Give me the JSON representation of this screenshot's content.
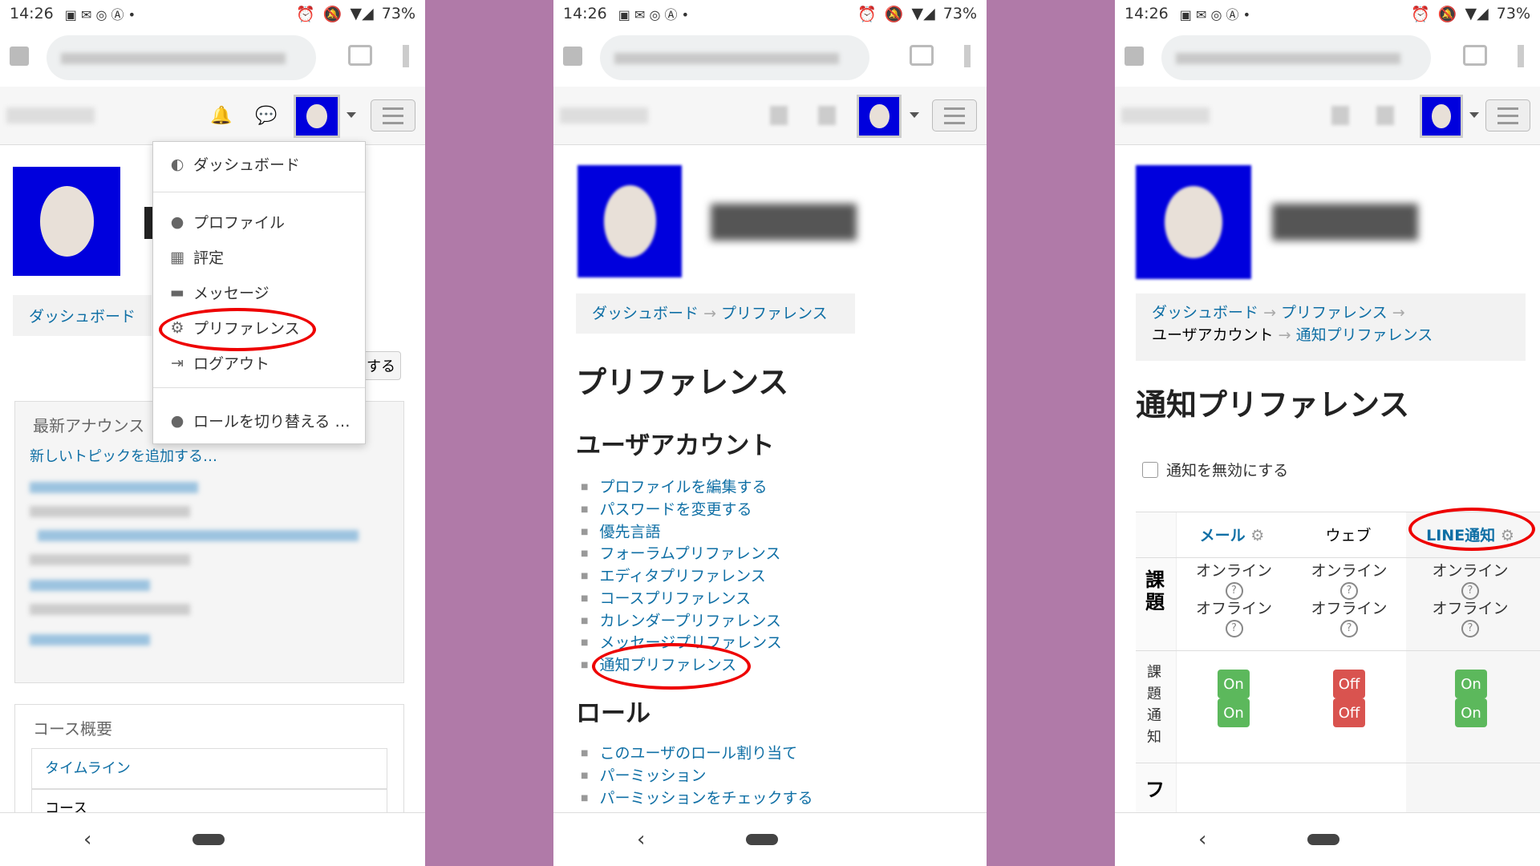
{
  "status": {
    "time": "14:26",
    "battery": "73%"
  },
  "panel1": {
    "menu": [
      {
        "icon": "dashboard-icon",
        "label": "ダッシュボード"
      },
      {
        "icon": "user-icon",
        "label": "プロファイル"
      },
      {
        "icon": "grades-icon",
        "label": "評定"
      },
      {
        "icon": "message-icon",
        "label": "メッセージ"
      },
      {
        "icon": "gear-icon",
        "label": "プリファレンス"
      },
      {
        "icon": "logout-icon",
        "label": "ログアウト"
      },
      {
        "icon": "user-icon",
        "label": "ロールを切り替える …"
      }
    ],
    "breadcrumb": "ダッシュボード",
    "button_partial": "する",
    "announcements_title": "最新アナウンス",
    "add_topic": "新しいトピックを追加する…",
    "course_overview_title": "コース概要",
    "tab_timeline": "タイムライン",
    "tab_courses": "コース"
  },
  "panel2": {
    "breadcrumb": [
      "ダッシュボード",
      "プリファレンス"
    ],
    "title": "プリファレンス",
    "section_user": "ユーザアカウント",
    "user_links": [
      "プロファイルを編集する",
      "パスワードを変更する",
      "優先言語",
      "フォーラムプリファレンス",
      "エディタプリファレンス",
      "コースプリファレンス",
      "カレンダープリファレンス",
      "メッセージプリファレンス",
      "通知プリファレンス"
    ],
    "section_roles": "ロール",
    "role_links": [
      "このユーザのロール割り当て",
      "パーミッション",
      "パーミッションをチェックする"
    ]
  },
  "panel3": {
    "breadcrumb": [
      "ダッシュボード",
      "プリファレンス",
      "ユーザアカウント",
      "通知プリファレンス"
    ],
    "title": "通知プリファレンス",
    "disable_label": "通知を無効にする",
    "columns": [
      "メール",
      "ウェブ",
      "LINE通知"
    ],
    "row_group": "課題",
    "online": "オンライン",
    "offline": "オフライン",
    "row_item": "課題通知",
    "toggles": [
      [
        "On",
        "On"
      ],
      [
        "Off",
        "Off"
      ],
      [
        "On",
        "On"
      ]
    ],
    "next_row": "フ"
  }
}
